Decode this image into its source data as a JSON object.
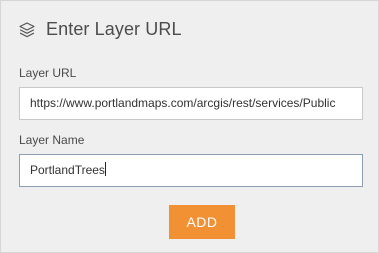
{
  "panel": {
    "title": "Enter Layer URL",
    "title_icon": "layers-icon"
  },
  "fields": {
    "url_label": "Layer URL",
    "url_value": "https://www.portlandmaps.com/arcgis/rest/services/Public",
    "name_label": "Layer Name",
    "name_value": "PortlandTrees"
  },
  "actions": {
    "add_label": "ADD"
  },
  "colors": {
    "accent": "#f29134",
    "panel_bg": "#efefef"
  }
}
